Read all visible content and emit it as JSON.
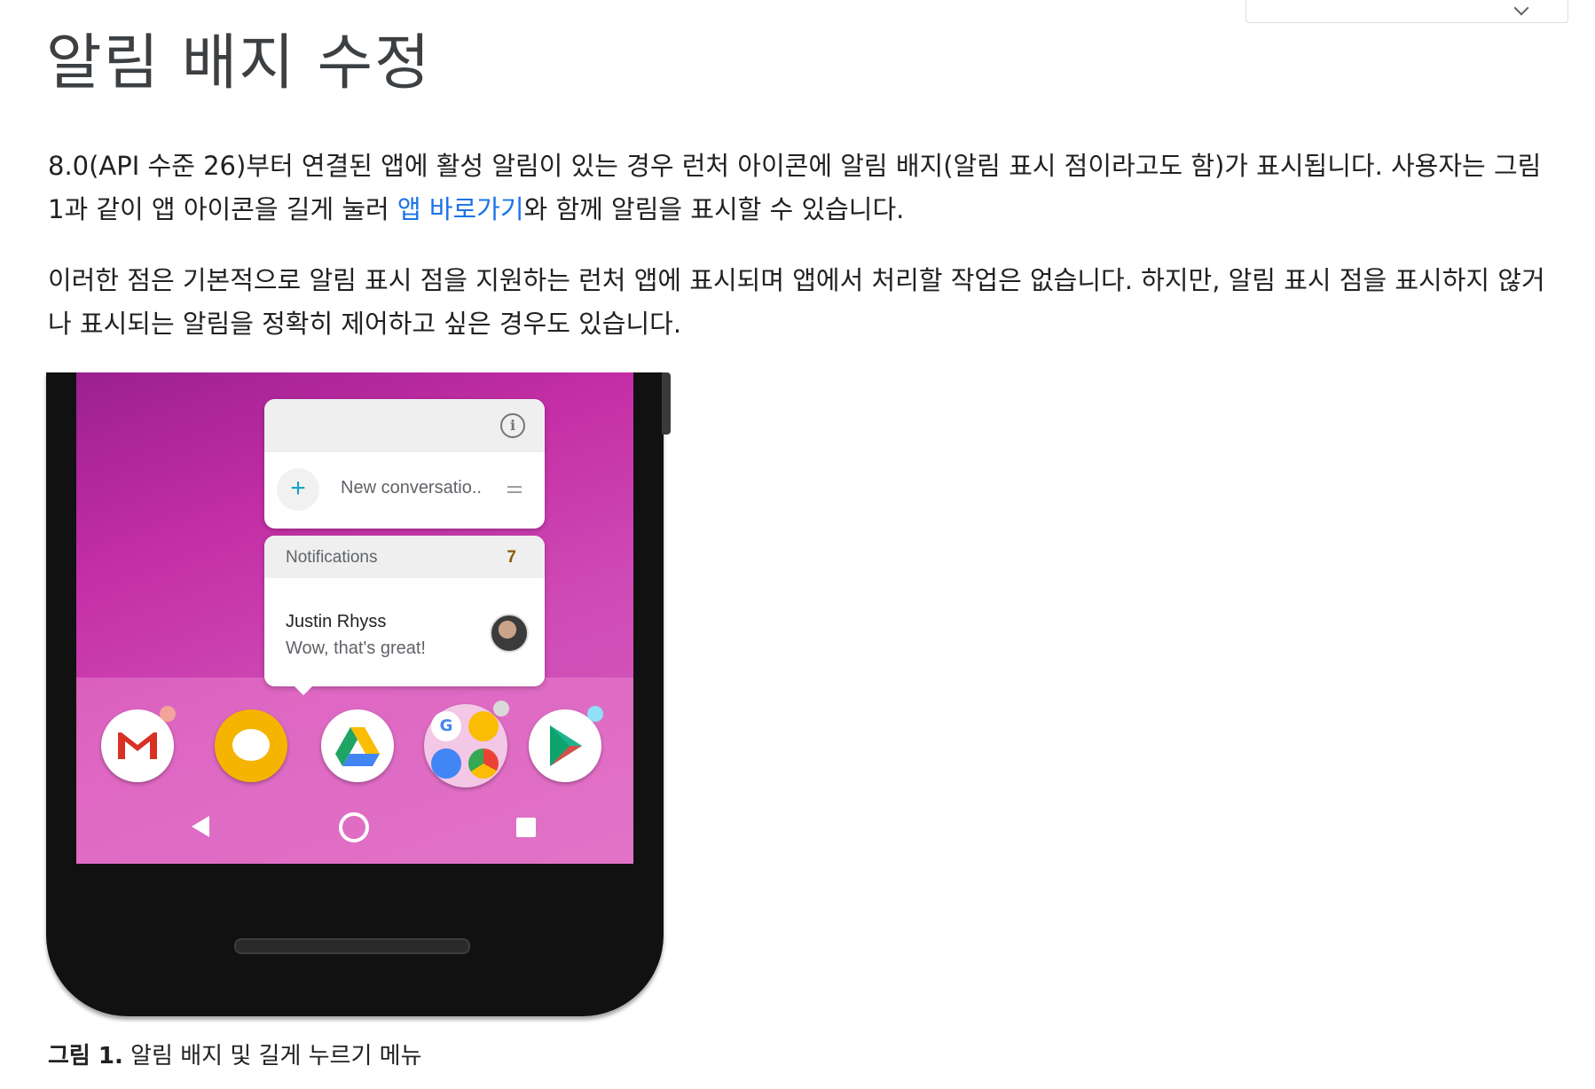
{
  "header": {
    "title": "알림 배지 수정"
  },
  "content": {
    "para1_before": "8.0(API 수준 26)부터 연결된 앱에 활성 알림이 있는 경우 런처 아이콘에 알림 배지(알림 표시 점이라고도 함)가 표시됩니다. 사용자는 그림 1과 같이 앱 아이콘을 길게 눌러 ",
    "para1_link": "앱 바로가기",
    "para1_after": "와 함께 알림을 표시할 수 있습니다.",
    "para2": "이러한 점은 기본적으로 알림 표시 점을 지원하는 런처 앱에 표시되며 앱에서 처리할 작업은 없습니다. 하지만, 알림 표시 점을 표시하지 않거나 표시되는 알림을 정확히 제어하고 싶은 경우도 있습니다."
  },
  "figure": {
    "shortcut_label": "New conversatio..",
    "notifications_title": "Notifications",
    "notifications_count": "7",
    "sender": "Justin Rhyss",
    "message": "Wow, that's great!",
    "plus_symbol": "+",
    "info_symbol": "i",
    "apps": [
      "gmail-icon",
      "allo-icon",
      "drive-icon",
      "google-folder-icon",
      "play-store-icon"
    ],
    "badge_colors": {
      "gmail": "#f4a39a",
      "folder": "#d9d9d9",
      "play": "#8fe0f5"
    },
    "caption_label": "그림 1.",
    "caption_text": " 알림 배지 및 길게 누르기 메뉴"
  }
}
